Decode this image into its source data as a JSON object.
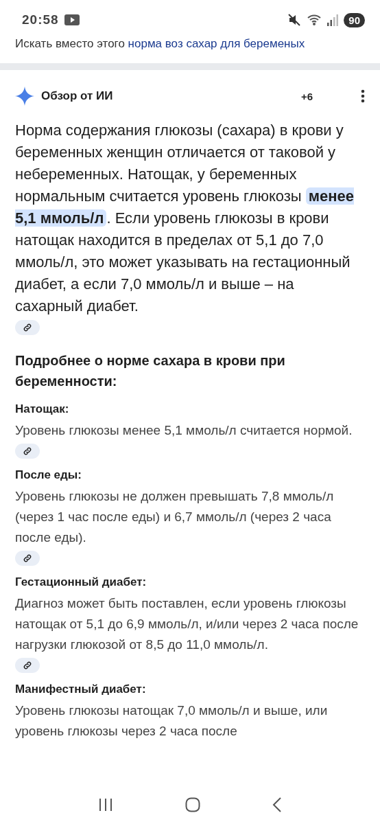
{
  "status_bar": {
    "time": "20:58",
    "battery": "90"
  },
  "suggestion": {
    "prefix": "Искать вместо этого",
    "query": "норма воз сахар для беременых"
  },
  "overview": {
    "title": "Обзор от ИИ",
    "source_count": "+6",
    "summary": "Норма содержания глюкозы (сахара) в крови у беременных женщин отличается от таковой у небеременных. Натощак, у беременных нормальным считается уровень глюкозы **менее 5,1 ммоль/л**. Если уровень глюкозы в крови натощак находится в пределах от 5,1 до 7,0 ммоль/л, это может указывать на гестационный диабет, а если 7,0 ммоль/л и выше – на сахарный диабет.",
    "summary_link": true,
    "subheading": "Подробнее о норме сахара в крови при беременности:",
    "sections": [
      {
        "heading": "Натощак:",
        "text": "Уровень глюкозы менее 5,1 ммоль/л считается нормой.",
        "link": true
      },
      {
        "heading": "После еды:",
        "text": "Уровень глюкозы не должен превышать 7,8 ммоль/л (через 1 час после еды) и 6,7 ммоль/л (через 2 часа после еды).",
        "link": true
      },
      {
        "heading": "Гестационный диабет:",
        "text": "Диагноз может быть поставлен, если уровень глюкозы натощак от 5,1 до 6,9 ммоль/л, и/или через 2 часа после нагрузки глюкозой от 8,5 до 11,0 ммоль/л.",
        "link": true
      },
      {
        "heading": "Манифестный диабет:",
        "text": "Уровень глюкозы натощак 7,0 ммоль/л и выше, или уровень глюкозы через 2 часа после"
      }
    ]
  }
}
